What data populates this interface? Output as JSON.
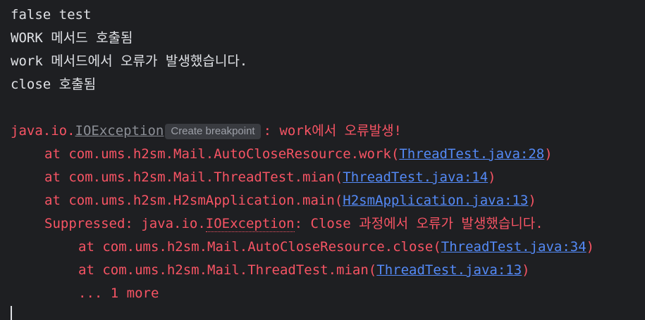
{
  "output_lines": [
    "false test",
    "WORK 메서드 호출됨",
    "work 메서드에서 오류가 발생했습니다.",
    "close 호출됨"
  ],
  "exception": {
    "prefix": "java.io.",
    "class_name": "IOException",
    "breakpoint_label": "Create breakpoint",
    "message": ": work에서 오류발생!"
  },
  "stack": [
    {
      "prefix": "at com.ums.h2sm.Mail.AutoCloseResource.work(",
      "link": "ThreadTest.java:28",
      "suffix": ")"
    },
    {
      "prefix": "at com.ums.h2sm.Mail.ThreadTest.mian(",
      "link": "ThreadTest.java:14",
      "suffix": ")"
    },
    {
      "prefix": "at com.ums.h2sm.H2smApplication.main(",
      "link": "H2smApplication.java:13",
      "suffix": ")"
    }
  ],
  "suppressed": {
    "prefix": "Suppressed: java.io.",
    "class_name": "IOException",
    "message": ": Close 과정에서 오류가 발생했습니다."
  },
  "suppressed_stack": [
    {
      "prefix": "at com.ums.h2sm.Mail.AutoCloseResource.close(",
      "link": "ThreadTest.java:34",
      "suffix": ")"
    },
    {
      "prefix": "at com.ums.h2sm.Mail.ThreadTest.mian(",
      "link": "ThreadTest.java:13",
      "suffix": ")"
    }
  ],
  "more_text": "... 1 more",
  "colors": {
    "background": "#1e1f22",
    "default_text": "#dfe1e5",
    "error_text": "#f75464",
    "link": "#548af7",
    "muted": "#8c8f96"
  }
}
